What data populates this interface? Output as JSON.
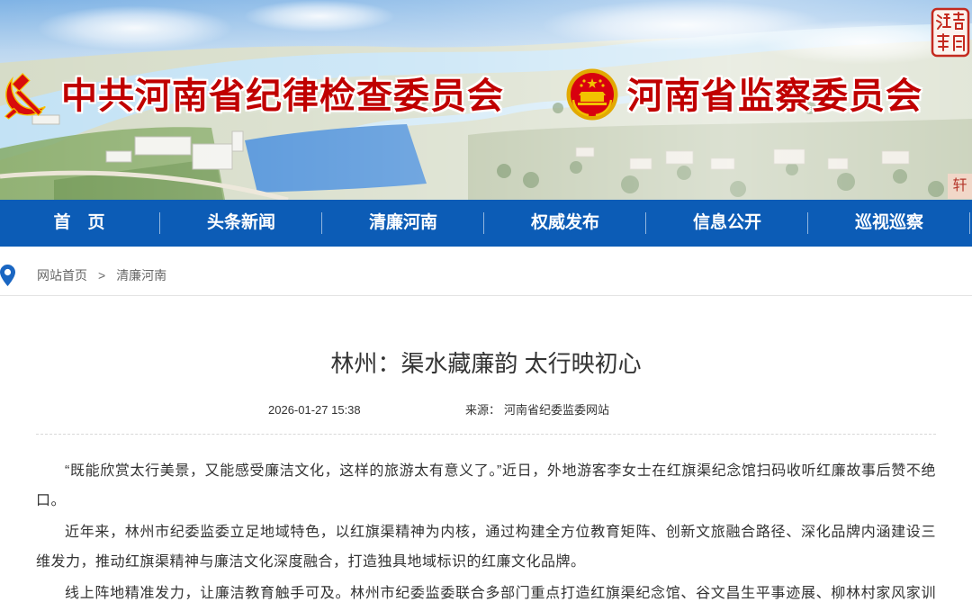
{
  "header": {
    "party_title": "中共河南省纪律检查委员会",
    "commission_title": "河南省监察委员会",
    "side_tab": "轩",
    "icons": {
      "party_emblem": "party-emblem-icon",
      "national_emblem": "national-emblem-icon",
      "seal": "seal-stamp-icon"
    }
  },
  "nav": {
    "items": [
      {
        "label": "首　页"
      },
      {
        "label": "头条新闻"
      },
      {
        "label": "清廉河南"
      },
      {
        "label": "权威发布"
      },
      {
        "label": "信息公开"
      },
      {
        "label": "巡视巡察"
      }
    ]
  },
  "breadcrumb": {
    "icon": "location-pin-icon",
    "items": [
      "网站首页",
      "清廉河南"
    ],
    "separator": ">"
  },
  "article": {
    "title": "林州：渠水藏廉韵 太行映初心",
    "date": "2026-01-27 15:38",
    "source_label": "来源：",
    "source": "河南省纪委监委网站",
    "paragraphs": [
      "“既能欣赏太行美景，又能感受廉洁文化，这样的旅游太有意义了。”近日，外地游客李女士在红旗渠纪念馆扫码收听红廉故事后赞不绝口。",
      "近年来，林州市纪委监委立足地域特色，以红旗渠精神为内核，通过构建全方位教育矩阵、创新文旅融合路径、深化品牌内涵建设三维发力，推动红旗渠精神与廉洁文化深度融合，打造独具地域标识的红廉文化品牌。",
      "线上阵地精准发力，让廉洁教育触手可及。林州市纪委监委联合多部门重点打造红旗渠纪念馆、谷文昌生平事迹展、柳林村家风家训馆"
    ]
  },
  "colors": {
    "nav_bg": "#0c5cb6",
    "title_red": "#c00000",
    "pin_blue": "#1a66c2",
    "text": "#333333",
    "crumb_text": "#666666",
    "seal_red": "#c42a1f"
  }
}
